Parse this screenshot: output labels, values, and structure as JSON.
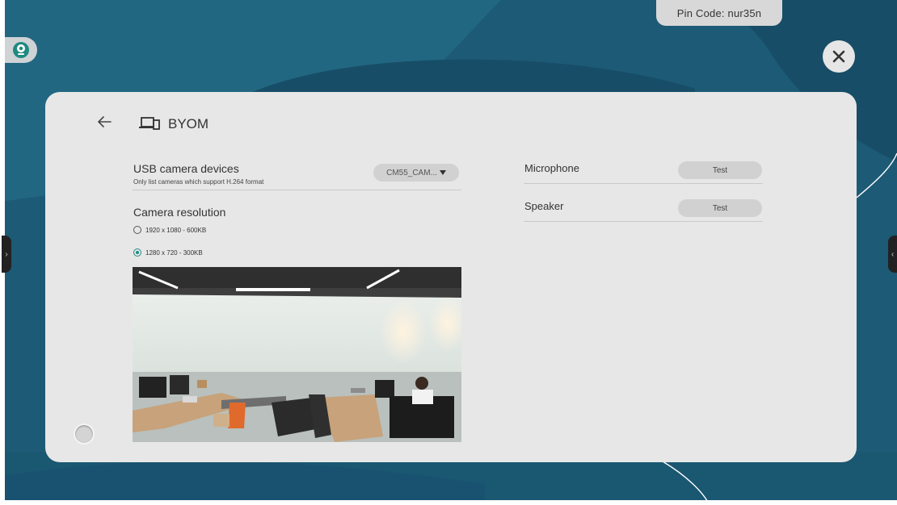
{
  "pin": {
    "label": "Pin Code:",
    "code": "nur35n"
  },
  "header": {
    "title": "BYOM"
  },
  "camera": {
    "label": "USB camera devices",
    "sublabel": "Only list cameras which support H.264 format",
    "selected": "CM55_CAM..."
  },
  "resolution": {
    "label": "Camera resolution",
    "options": [
      {
        "label": "1920 x 1080 - 600KB",
        "checked": false
      },
      {
        "label": "1280 x 720 - 300KB",
        "checked": true
      }
    ]
  },
  "audio": {
    "microphone_label": "Microphone",
    "speaker_label": "Speaker",
    "test_label": "Test"
  },
  "icons": [
    "webcam-icon",
    "close-icon",
    "back-arrow-icon",
    "devices-icon",
    "chevron-left-icon",
    "chevron-right-icon",
    "dropdown-arrow-icon"
  ],
  "colors": {
    "accent": "#1f8a80",
    "panel": "#e7e7e7",
    "background": "#1f5b76"
  }
}
